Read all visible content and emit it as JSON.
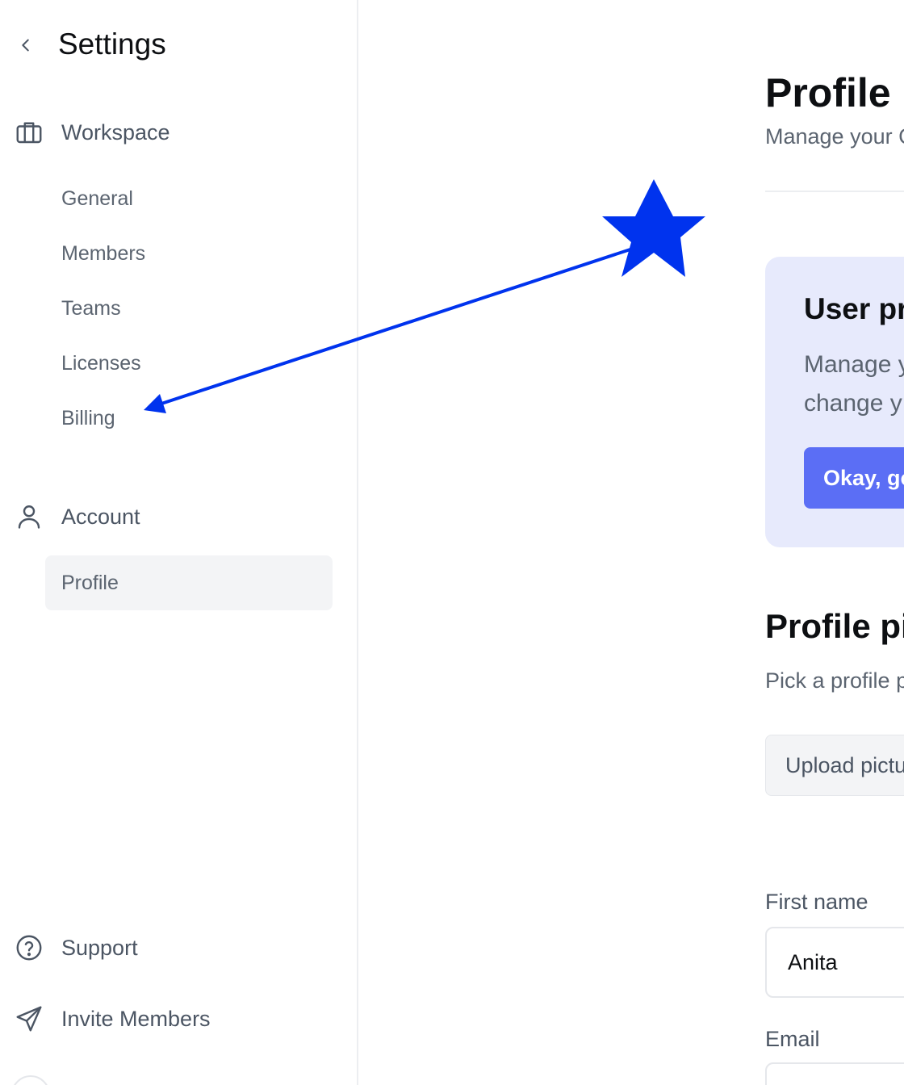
{
  "sidebar": {
    "title": "Settings",
    "workspace": {
      "label": "Workspace",
      "items": [
        {
          "label": "General"
        },
        {
          "label": "Members"
        },
        {
          "label": "Teams"
        },
        {
          "label": "Licenses"
        },
        {
          "label": "Billing"
        }
      ]
    },
    "account": {
      "label": "Account",
      "items": [
        {
          "label": "Profile",
          "active": true
        }
      ]
    },
    "footer": {
      "support": "Support",
      "invite": "Invite Members"
    }
  },
  "main": {
    "title": "Profile",
    "subtitle": "Manage your C",
    "callout": {
      "title": "User pr",
      "text_line1": "Manage y",
      "text_line2": "change y",
      "button": "Okay, go"
    },
    "picture": {
      "title": "Profile pic",
      "subtitle": "Pick a profile p",
      "upload_button": "Upload pictu"
    },
    "form": {
      "first_name_label": "First name",
      "first_name_value": "Anita",
      "email_label": "Email",
      "email_value": ""
    }
  },
  "annotation": {
    "color": "#0033ee"
  },
  "colors": {
    "accent": "#5b6ef5",
    "callout_bg": "#e7eafc",
    "active_item_bg": "#f3f4f6"
  }
}
